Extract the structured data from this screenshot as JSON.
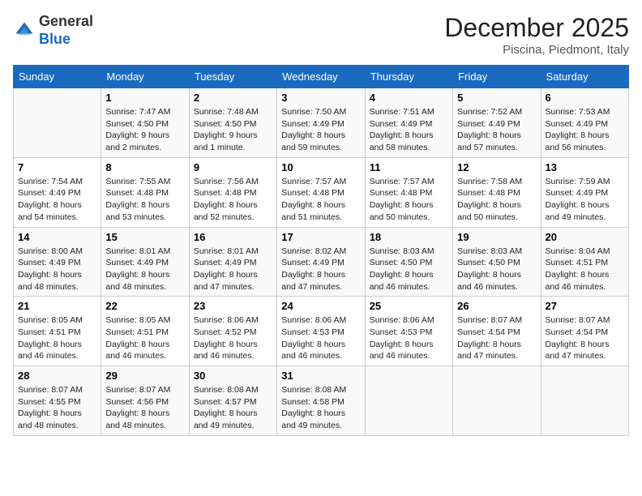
{
  "header": {
    "logo_line1": "General",
    "logo_line2": "Blue",
    "month_title": "December 2025",
    "location": "Piscina, Piedmont, Italy"
  },
  "days_of_week": [
    "Sunday",
    "Monday",
    "Tuesday",
    "Wednesday",
    "Thursday",
    "Friday",
    "Saturday"
  ],
  "weeks": [
    [
      {
        "day": "",
        "info": ""
      },
      {
        "day": "1",
        "info": "Sunrise: 7:47 AM\nSunset: 4:50 PM\nDaylight: 9 hours\nand 2 minutes."
      },
      {
        "day": "2",
        "info": "Sunrise: 7:48 AM\nSunset: 4:50 PM\nDaylight: 9 hours\nand 1 minute."
      },
      {
        "day": "3",
        "info": "Sunrise: 7:50 AM\nSunset: 4:49 PM\nDaylight: 8 hours\nand 59 minutes."
      },
      {
        "day": "4",
        "info": "Sunrise: 7:51 AM\nSunset: 4:49 PM\nDaylight: 8 hours\nand 58 minutes."
      },
      {
        "day": "5",
        "info": "Sunrise: 7:52 AM\nSunset: 4:49 PM\nDaylight: 8 hours\nand 57 minutes."
      },
      {
        "day": "6",
        "info": "Sunrise: 7:53 AM\nSunset: 4:49 PM\nDaylight: 8 hours\nand 56 minutes."
      }
    ],
    [
      {
        "day": "7",
        "info": "Sunrise: 7:54 AM\nSunset: 4:49 PM\nDaylight: 8 hours\nand 54 minutes."
      },
      {
        "day": "8",
        "info": "Sunrise: 7:55 AM\nSunset: 4:48 PM\nDaylight: 8 hours\nand 53 minutes."
      },
      {
        "day": "9",
        "info": "Sunrise: 7:56 AM\nSunset: 4:48 PM\nDaylight: 8 hours\nand 52 minutes."
      },
      {
        "day": "10",
        "info": "Sunrise: 7:57 AM\nSunset: 4:48 PM\nDaylight: 8 hours\nand 51 minutes."
      },
      {
        "day": "11",
        "info": "Sunrise: 7:57 AM\nSunset: 4:48 PM\nDaylight: 8 hours\nand 50 minutes."
      },
      {
        "day": "12",
        "info": "Sunrise: 7:58 AM\nSunset: 4:48 PM\nDaylight: 8 hours\nand 50 minutes."
      },
      {
        "day": "13",
        "info": "Sunrise: 7:59 AM\nSunset: 4:49 PM\nDaylight: 8 hours\nand 49 minutes."
      }
    ],
    [
      {
        "day": "14",
        "info": "Sunrise: 8:00 AM\nSunset: 4:49 PM\nDaylight: 8 hours\nand 48 minutes."
      },
      {
        "day": "15",
        "info": "Sunrise: 8:01 AM\nSunset: 4:49 PM\nDaylight: 8 hours\nand 48 minutes."
      },
      {
        "day": "16",
        "info": "Sunrise: 8:01 AM\nSunset: 4:49 PM\nDaylight: 8 hours\nand 47 minutes."
      },
      {
        "day": "17",
        "info": "Sunrise: 8:02 AM\nSunset: 4:49 PM\nDaylight: 8 hours\nand 47 minutes."
      },
      {
        "day": "18",
        "info": "Sunrise: 8:03 AM\nSunset: 4:50 PM\nDaylight: 8 hours\nand 46 minutes."
      },
      {
        "day": "19",
        "info": "Sunrise: 8:03 AM\nSunset: 4:50 PM\nDaylight: 8 hours\nand 46 minutes."
      },
      {
        "day": "20",
        "info": "Sunrise: 8:04 AM\nSunset: 4:51 PM\nDaylight: 8 hours\nand 46 minutes."
      }
    ],
    [
      {
        "day": "21",
        "info": "Sunrise: 8:05 AM\nSunset: 4:51 PM\nDaylight: 8 hours\nand 46 minutes."
      },
      {
        "day": "22",
        "info": "Sunrise: 8:05 AM\nSunset: 4:51 PM\nDaylight: 8 hours\nand 46 minutes."
      },
      {
        "day": "23",
        "info": "Sunrise: 8:06 AM\nSunset: 4:52 PM\nDaylight: 8 hours\nand 46 minutes."
      },
      {
        "day": "24",
        "info": "Sunrise: 8:06 AM\nSunset: 4:53 PM\nDaylight: 8 hours\nand 46 minutes."
      },
      {
        "day": "25",
        "info": "Sunrise: 8:06 AM\nSunset: 4:53 PM\nDaylight: 8 hours\nand 46 minutes."
      },
      {
        "day": "26",
        "info": "Sunrise: 8:07 AM\nSunset: 4:54 PM\nDaylight: 8 hours\nand 47 minutes."
      },
      {
        "day": "27",
        "info": "Sunrise: 8:07 AM\nSunset: 4:54 PM\nDaylight: 8 hours\nand 47 minutes."
      }
    ],
    [
      {
        "day": "28",
        "info": "Sunrise: 8:07 AM\nSunset: 4:55 PM\nDaylight: 8 hours\nand 48 minutes."
      },
      {
        "day": "29",
        "info": "Sunrise: 8:07 AM\nSunset: 4:56 PM\nDaylight: 8 hours\nand 48 minutes."
      },
      {
        "day": "30",
        "info": "Sunrise: 8:08 AM\nSunset: 4:57 PM\nDaylight: 8 hours\nand 49 minutes."
      },
      {
        "day": "31",
        "info": "Sunrise: 8:08 AM\nSunset: 4:58 PM\nDaylight: 8 hours\nand 49 minutes."
      },
      {
        "day": "",
        "info": ""
      },
      {
        "day": "",
        "info": ""
      },
      {
        "day": "",
        "info": ""
      }
    ]
  ]
}
